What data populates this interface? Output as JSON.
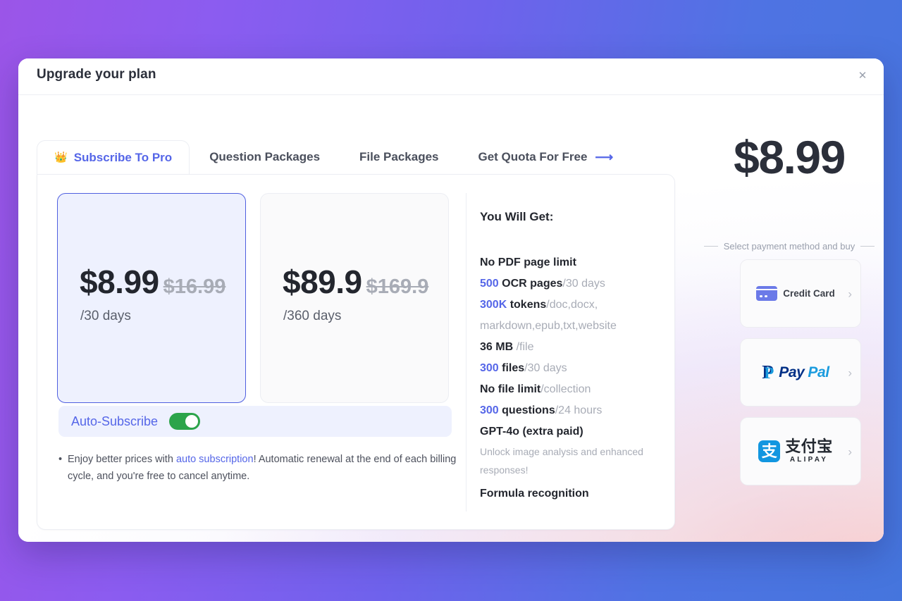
{
  "window": {
    "title": "Upgrade your plan",
    "close_icon": "✕"
  },
  "tabs": [
    {
      "label": "Subscribe To Pro",
      "active": true,
      "icon": "crown-icon"
    },
    {
      "label": "Question Packages",
      "active": false
    },
    {
      "label": "File Packages",
      "active": false
    },
    {
      "label": "Get Quota For Free",
      "active": false,
      "icon": "arrow-right-icon"
    }
  ],
  "plans": [
    {
      "price": "$8.99",
      "old_price": "$16.99",
      "period": "/30 days",
      "selected": true
    },
    {
      "price": "$89.9",
      "old_price": "$169.9",
      "period": "/360 days",
      "selected": false
    }
  ],
  "auto_subscribe": {
    "label": "Auto-Subscribe",
    "enabled": true
  },
  "note": {
    "bullet": "•",
    "prefix": "Enjoy better prices with ",
    "link": "auto subscription",
    "suffix": "! Automatic renewal at the end of each billing cycle, and you're free to cancel anytime."
  },
  "features": {
    "title": "You Will Get:",
    "items": [
      {
        "main": "No PDF page limit"
      },
      {
        "num": "500",
        "main": " OCR pages",
        "muted": "/30 days"
      },
      {
        "num": "300K",
        "main": " tokens",
        "muted": "/doc,docx, markdown,epub,txt,website"
      },
      {
        "main": "36 MB ",
        "muted": "/file"
      },
      {
        "num": "300",
        "main": " files",
        "muted": "/30 days"
      },
      {
        "main": "No file limit",
        "muted": "/collection"
      },
      {
        "num": "300",
        "main": " questions",
        "muted": "/24 hours"
      },
      {
        "main": "GPT-4o (extra paid)",
        "sub": "Unlock image analysis and enhanced responses!"
      },
      {
        "main": "Formula recognition"
      }
    ]
  },
  "checkout": {
    "total_price": "$8.99",
    "select_label": "Select payment method and buy",
    "methods": [
      {
        "name": "Credit Card",
        "id": "credit-card",
        "chevron": "›"
      },
      {
        "name": "PayPal",
        "id": "paypal",
        "chevron": "›",
        "mark_a": "Pay",
        "mark_b": "Pal",
        "glyph": "P"
      },
      {
        "name": "Alipay",
        "id": "alipay",
        "chevron": "›",
        "cn": "支付宝",
        "en": "ALIPAY",
        "glyph": "支"
      }
    ]
  },
  "colors": {
    "accent": "#5566e8",
    "accent_strong": "#4f5fe0",
    "toggle_on": "#2ca44a",
    "muted": "#a8acb6",
    "bg_gradient_from": "#9b55e8",
    "bg_gradient_to": "#4575dd"
  }
}
